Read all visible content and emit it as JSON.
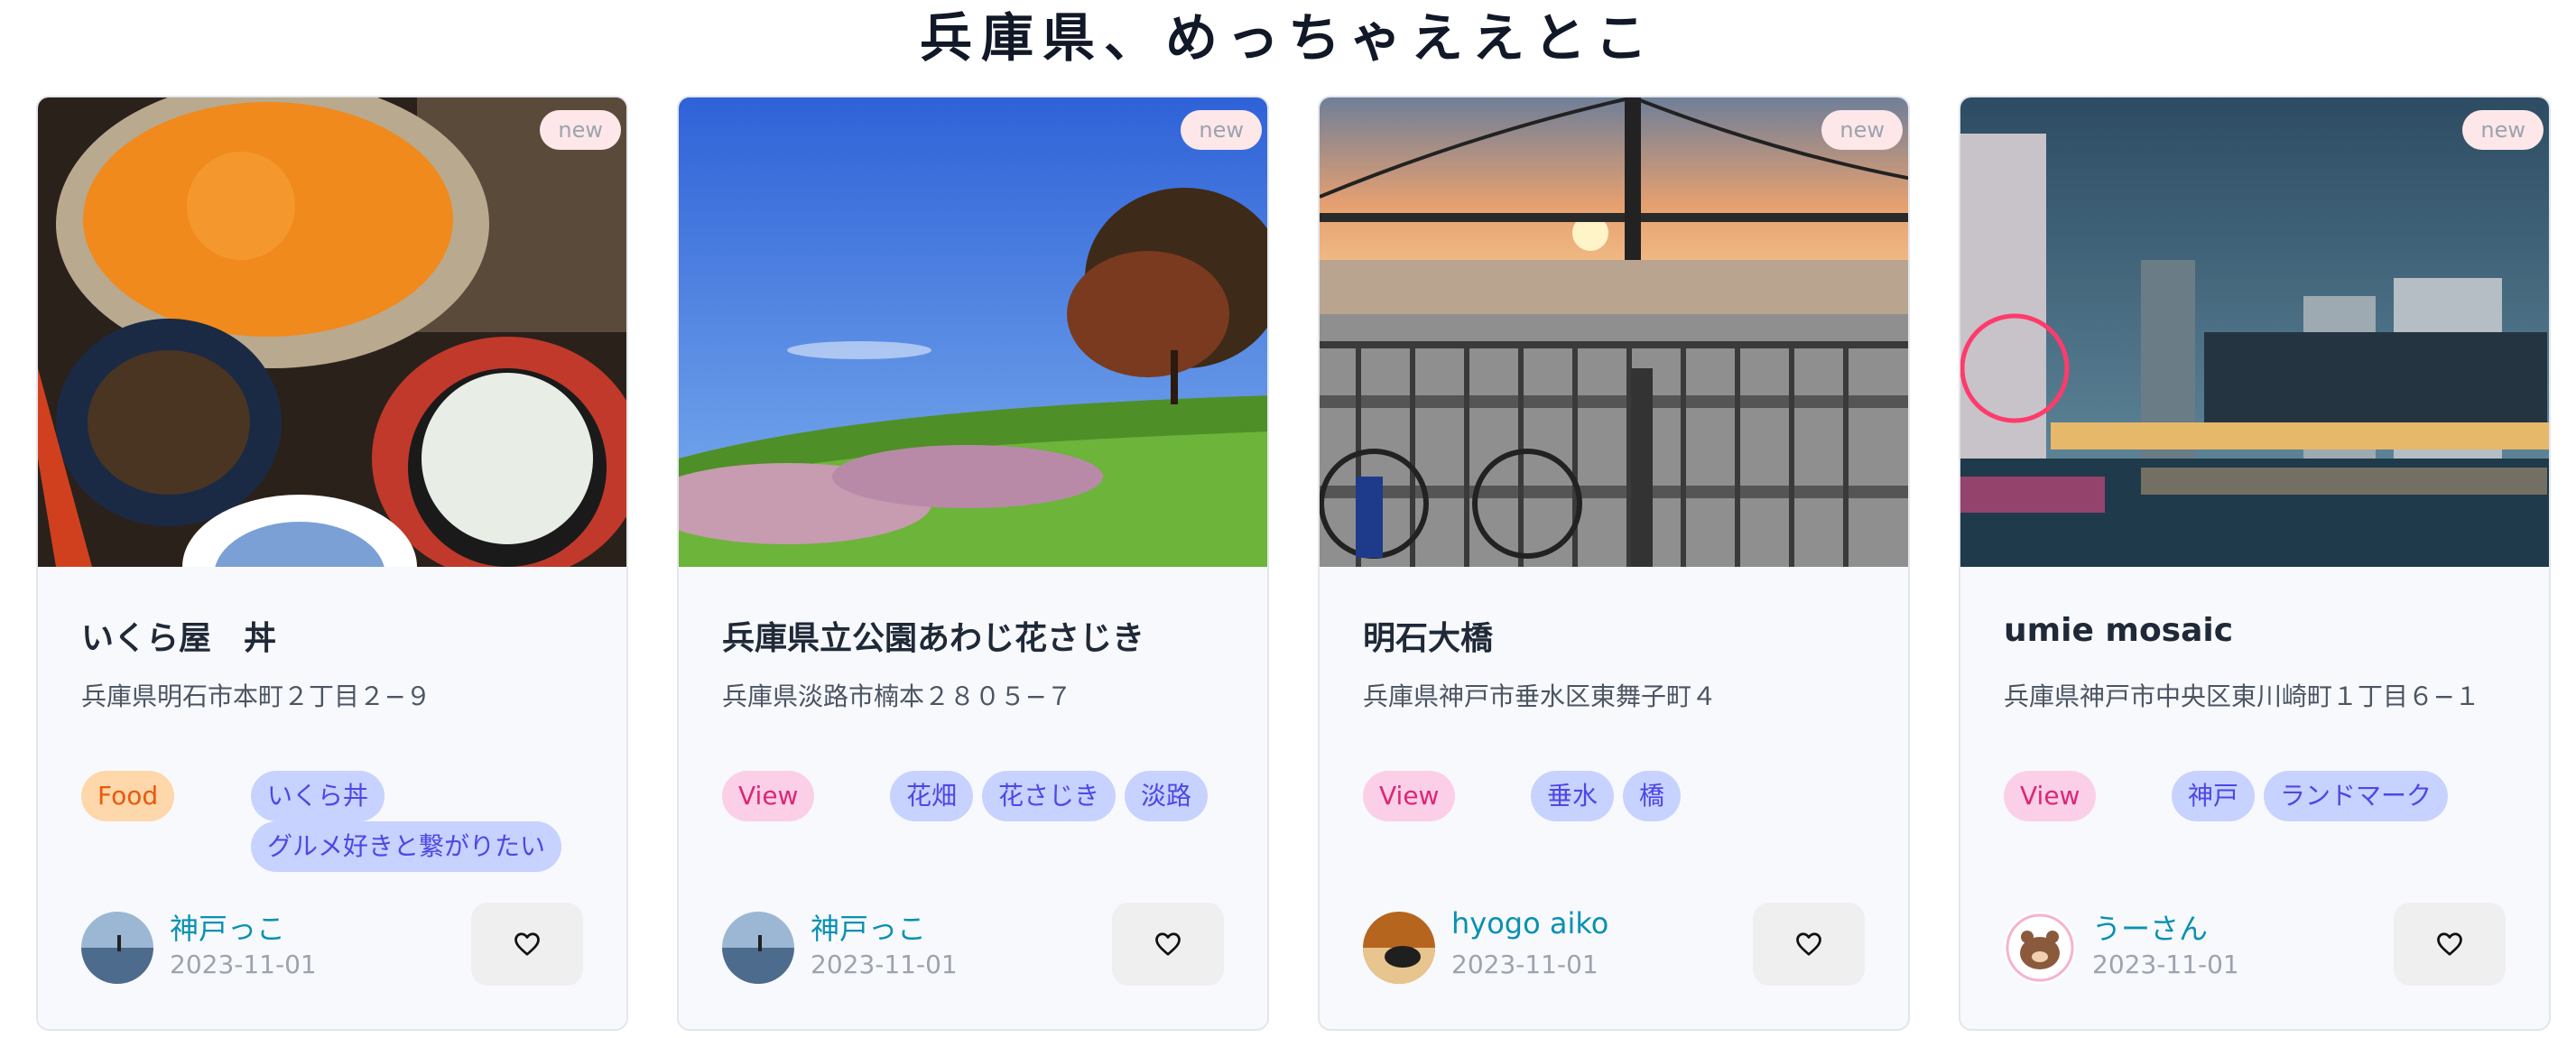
{
  "page": {
    "title": "兵庫県、めっちゃええとこ"
  },
  "cards": [
    {
      "badge": "new",
      "title": "いくら屋　丼",
      "address": "兵庫県明石市本町２丁目２−９",
      "category": "Food",
      "tags": [
        "いくら丼",
        "グルメ好きと繋がりたい"
      ],
      "author": "神戸っこ",
      "date": "2023-11-01",
      "photo_icon": "food-photo",
      "avatar_icon": "seaside-avatar"
    },
    {
      "badge": "new",
      "title": "兵庫県立公園あわじ花さじき",
      "address": "兵庫県淡路市楠本２８０５−７",
      "category": "View",
      "tags": [
        "花畑",
        "花さじき",
        "淡路"
      ],
      "author": "神戸っこ",
      "date": "2023-11-01",
      "photo_icon": "landscape-photo",
      "avatar_icon": "seaside-avatar"
    },
    {
      "badge": "new",
      "title": "明石大橋",
      "address": "兵庫県神戸市垂水区東舞子町４",
      "category": "View",
      "tags": [
        "垂水",
        "橋"
      ],
      "author": "hyogo aiko",
      "date": "2023-11-01",
      "photo_icon": "bridge-photo",
      "avatar_icon": "dog-avatar"
    },
    {
      "badge": "new",
      "title": "umie mosaic",
      "address": "兵庫県神戸市中央区東川崎町１丁目６−１",
      "category": "View",
      "tags": [
        "神戸",
        "ランドマーク"
      ],
      "author": "うーさん",
      "date": "2023-11-01",
      "photo_icon": "night-harbor-photo",
      "avatar_icon": "bear-avatar"
    }
  ],
  "colors": {
    "food_bg": "#fed7aa",
    "view_bg": "#fbcfe8",
    "tag_bg": "#c7d2fe",
    "author": "#0891b2"
  }
}
